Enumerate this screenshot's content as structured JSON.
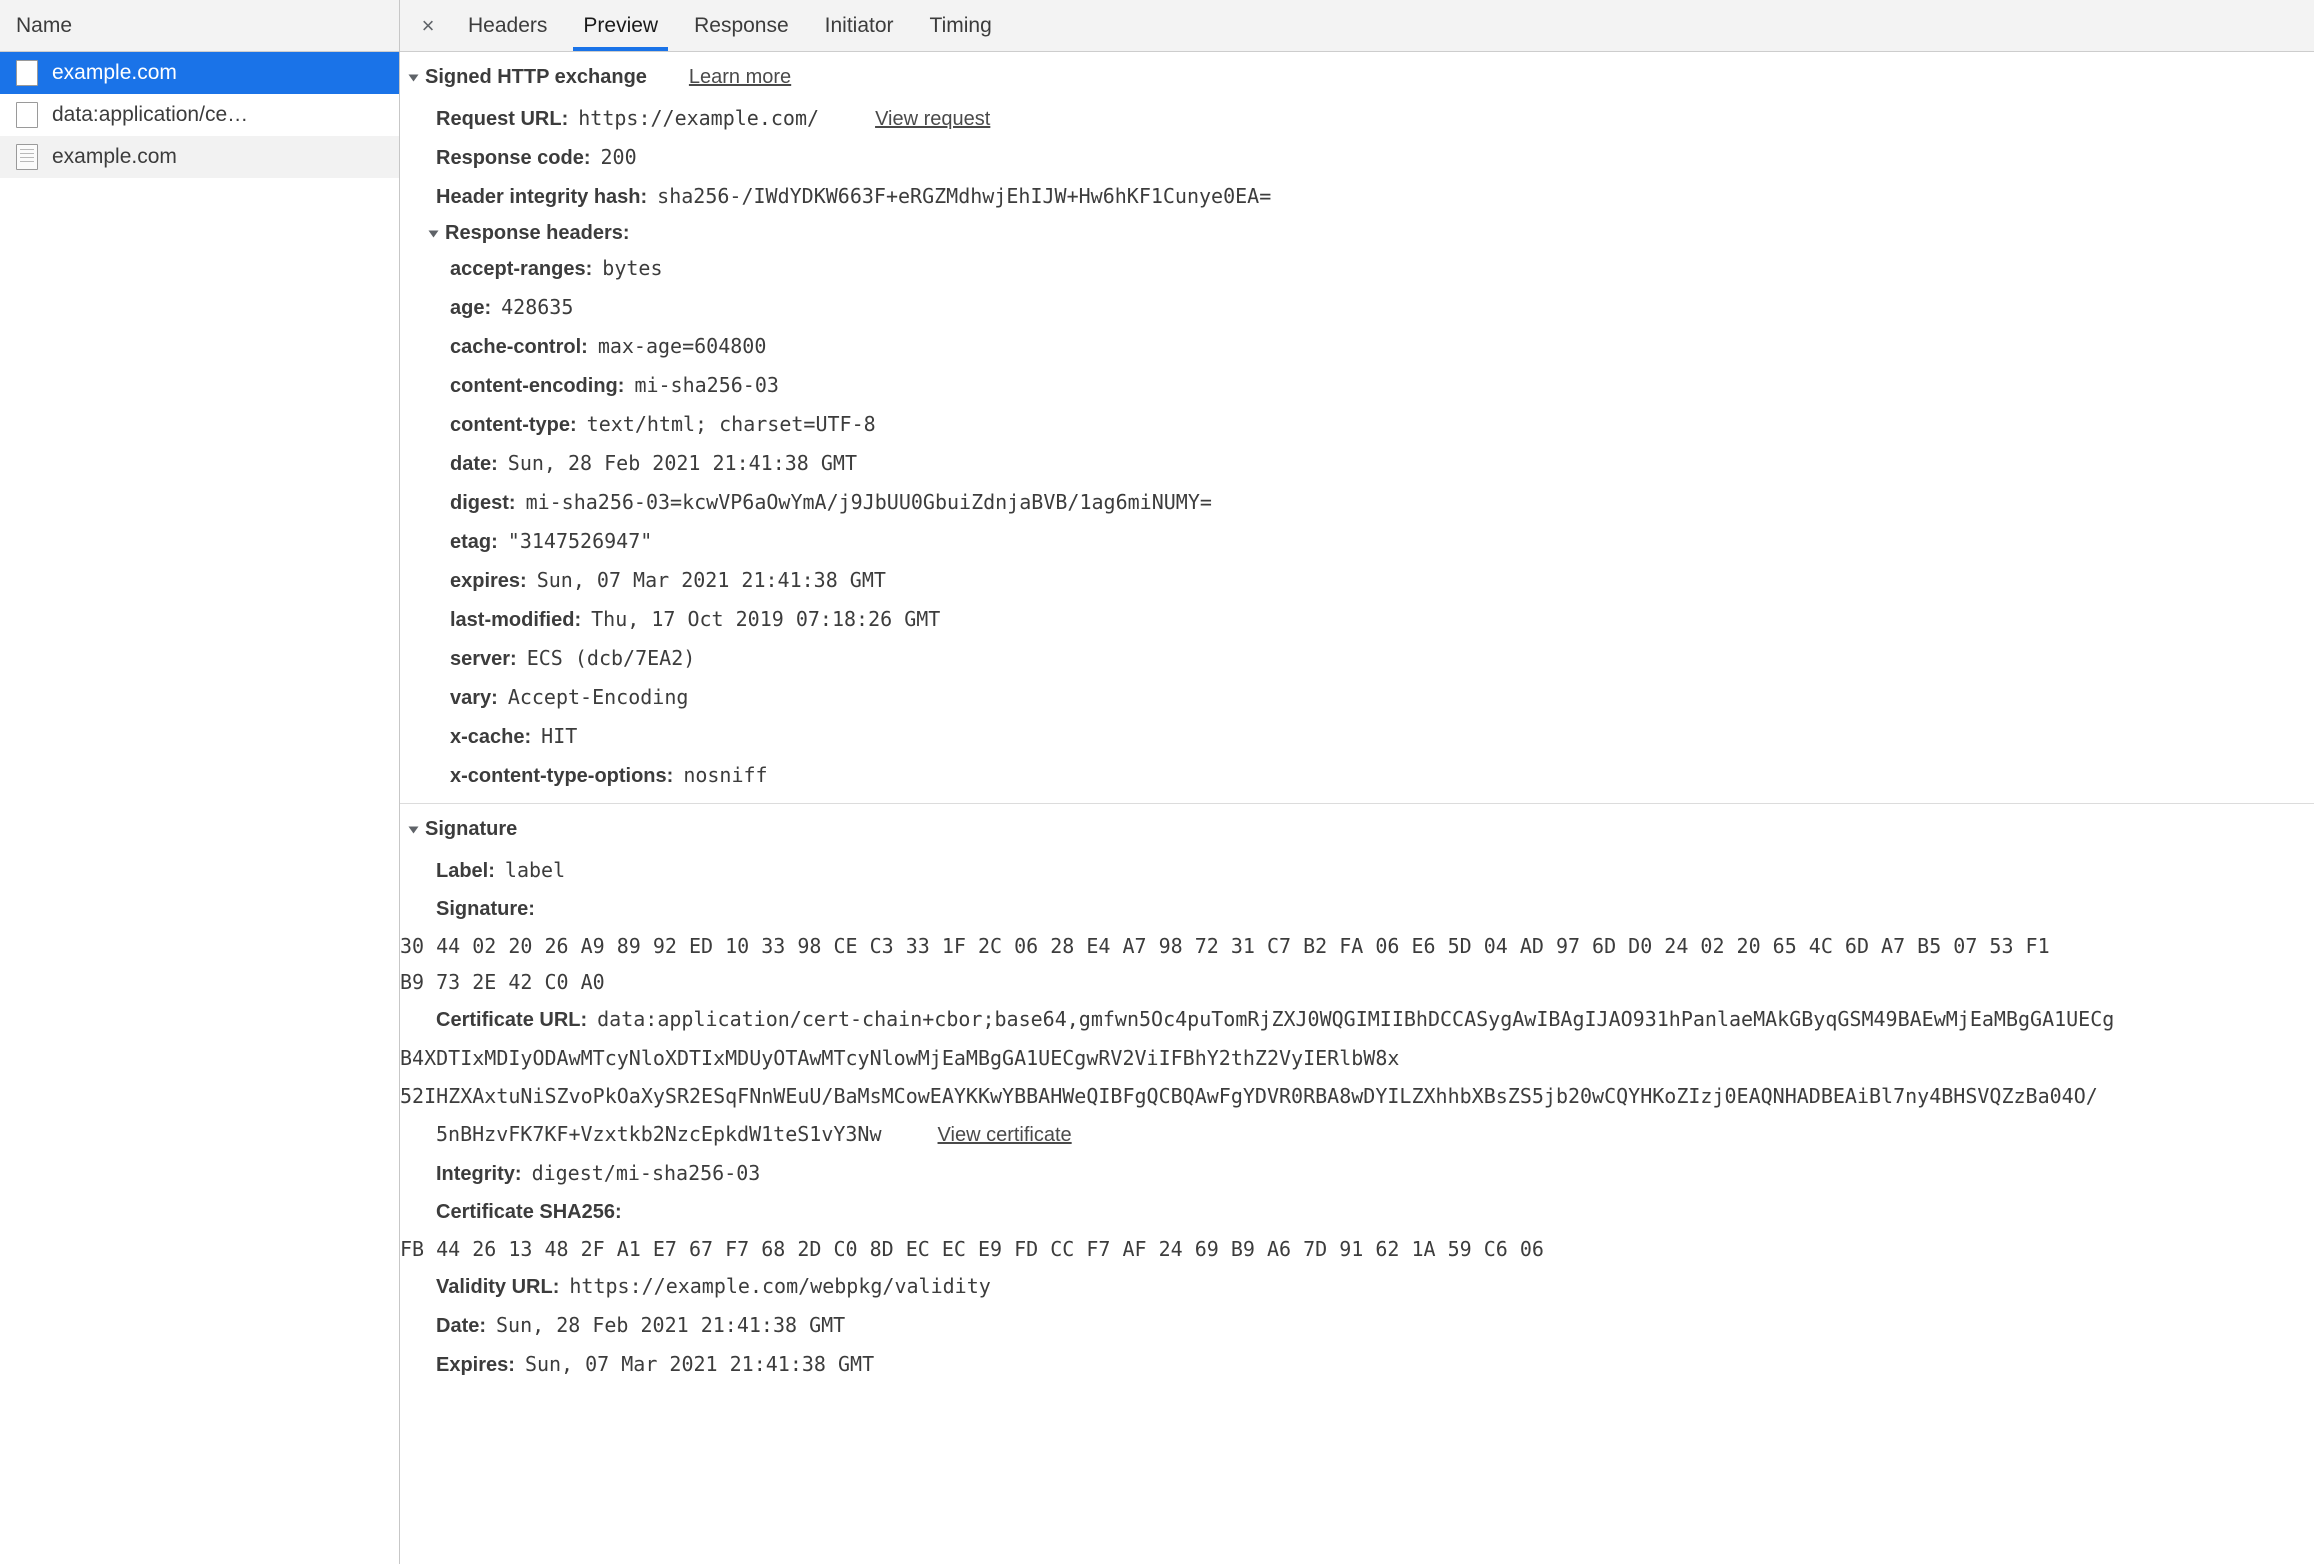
{
  "left_panel": {
    "column_header": "Name",
    "rows": [
      {
        "label": "example.com",
        "icon": "blank-file-icon",
        "selected": true,
        "striped": false
      },
      {
        "label": "data:application/ce…",
        "icon": "blank-file-icon",
        "selected": false,
        "striped": false
      },
      {
        "label": "example.com",
        "icon": "document-file-icon",
        "selected": false,
        "striped": true
      }
    ]
  },
  "tabbar": {
    "close_label": "×",
    "tabs": [
      {
        "label": "Headers",
        "active": false
      },
      {
        "label": "Preview",
        "active": true
      },
      {
        "label": "Response",
        "active": false
      },
      {
        "label": "Initiator",
        "active": false
      },
      {
        "label": "Timing",
        "active": false
      }
    ]
  },
  "colors": {
    "accent": "#1a73e8",
    "selected_row_bg": "#1a73e8",
    "header_bg": "#f3f3f3",
    "text": "#3c3c3c"
  },
  "sxg": {
    "title": "Signed HTTP exchange",
    "learn_more": "Learn more",
    "request_url_label": "Request URL:",
    "request_url_value": "https://example.com/",
    "view_request": "View request",
    "response_code_label": "Response code:",
    "response_code_value": "200",
    "header_integrity_label": "Header integrity hash:",
    "header_integrity_value": "sha256-/IWdYDKW663F+eRGZMdhwjEhIJW+Hw6hKF1Cunye0EA=",
    "response_headers_title": "Response headers:",
    "response_headers": [
      {
        "name": "accept-ranges:",
        "value": "bytes"
      },
      {
        "name": "age:",
        "value": "428635"
      },
      {
        "name": "cache-control:",
        "value": "max-age=604800"
      },
      {
        "name": "content-encoding:",
        "value": "mi-sha256-03"
      },
      {
        "name": "content-type:",
        "value": "text/html; charset=UTF-8"
      },
      {
        "name": "date:",
        "value": "Sun, 28 Feb 2021 21:41:38 GMT"
      },
      {
        "name": "digest:",
        "value": "mi-sha256-03=kcwVP6aOwYmA/j9JbUU0GbuiZdnjaBVB/1ag6miNUMY="
      },
      {
        "name": "etag:",
        "value": "\"3147526947\""
      },
      {
        "name": "expires:",
        "value": "Sun, 07 Mar 2021 21:41:38 GMT"
      },
      {
        "name": "last-modified:",
        "value": "Thu, 17 Oct 2019 07:18:26 GMT"
      },
      {
        "name": "server:",
        "value": "ECS (dcb/7EA2)"
      },
      {
        "name": "vary:",
        "value": "Accept-Encoding"
      },
      {
        "name": "x-cache:",
        "value": "HIT"
      },
      {
        "name": "x-content-type-options:",
        "value": "nosniff"
      }
    ]
  },
  "signature": {
    "title": "Signature",
    "label_label": "Label:",
    "label_value": "label",
    "signature_label": "Signature:",
    "signature_hex_lines": [
      "30 44 02 20 26 A9 89 92 ED 10 33 98 CE C3 33 1F 2C 06 28 E4 A7 98 72 31 C7 B2 FA 06 E6 5D 04 AD 97 6D D0 24 02 20 65 4C 6D A7 B5 07 53 F1",
      "B9 73 2E 42 C0 A0"
    ],
    "certificate_url_label": "Certificate URL:",
    "certificate_url_lines": [
      "data:application/cert-chain+cbor;base64,gmfwn5Oc4puTomRjZXJ0WQGIMIIBhDCCASygAwIBAgIJAO931hPanlaeMAkGByqGSM49BAEwMjEaMBgGA1UECg",
      "B4XDTIxMDIyODAwMTcyNloXDTIxMDUyOTAwMTcyNlowMjEaMBgGA1UECgwRV2ViIFBhY2thZ2VyIERlbW8x",
      "52IHZXAxtuNiSZvoPkOaXySR2ESqFNnWEuU/BaMsMCowEAYKKwYBBAHWeQIBFgQCBQAwFgYDVR0RBA8wDYILZXhhbXBsZS5jb20wCQYHKoZIzj0EAQNHADBEAiBl7ny4BHSVQZzBa04O/",
      "5nBHzvFK7KF+Vzxtkb2NzcEpkdW1teS1vY3Nw"
    ],
    "view_certificate": "View certificate",
    "integrity_label": "Integrity:",
    "integrity_value": "digest/mi-sha256-03",
    "cert_sha256_label": "Certificate SHA256:",
    "cert_sha256_hex": "FB 44 26 13 48 2F A1 E7 67 F7 68 2D C0 8D EC EC E9 FD CC F7 AF 24 69 B9 A6 7D 91 62 1A 59 C6 06",
    "validity_url_label": "Validity URL:",
    "validity_url_value": "https://example.com/webpkg/validity",
    "date_label": "Date:",
    "date_value": "Sun, 28 Feb 2021 21:41:38 GMT",
    "expires_label": "Expires:",
    "expires_value": "Sun, 07 Mar 2021 21:41:38 GMT"
  }
}
